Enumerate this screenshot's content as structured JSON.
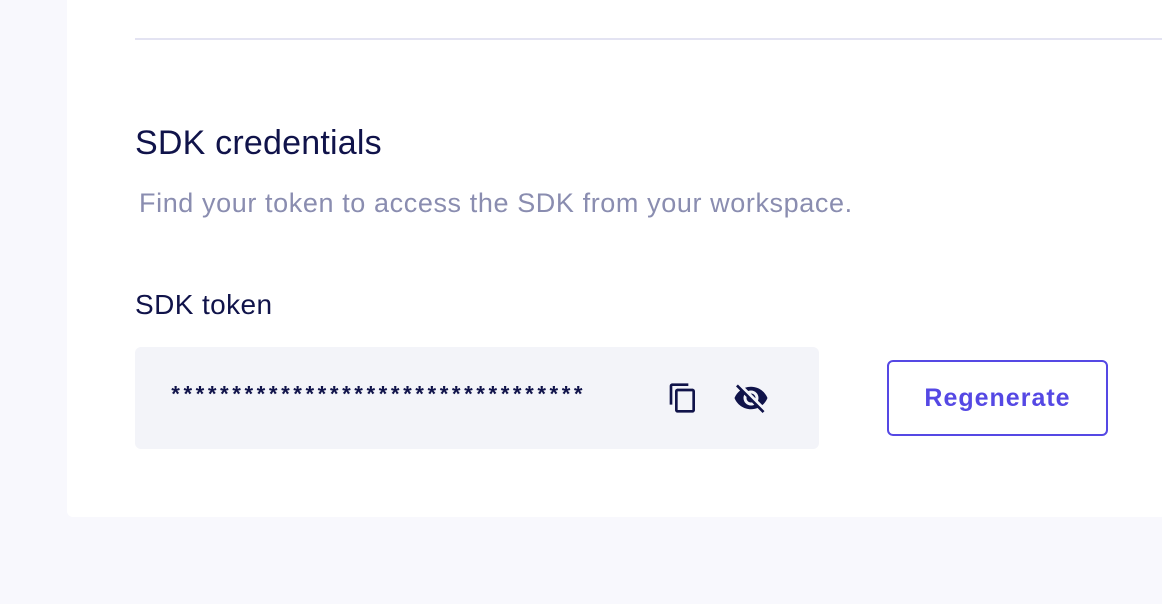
{
  "section": {
    "title": "SDK credentials",
    "subtitle": "Find your token to access the SDK from your workspace."
  },
  "token_field": {
    "label": "SDK token",
    "masked_value": "**********************************",
    "copy_icon": "copy-icon",
    "visibility_icon": "eye-off-icon"
  },
  "actions": {
    "regenerate_label": "Regenerate"
  },
  "colors": {
    "page_background": "#f8f8fd",
    "card_background": "#ffffff",
    "text_primary": "#10134a",
    "text_muted": "#8a8db0",
    "accent": "#5548e4",
    "field_background": "#f3f4f9"
  }
}
